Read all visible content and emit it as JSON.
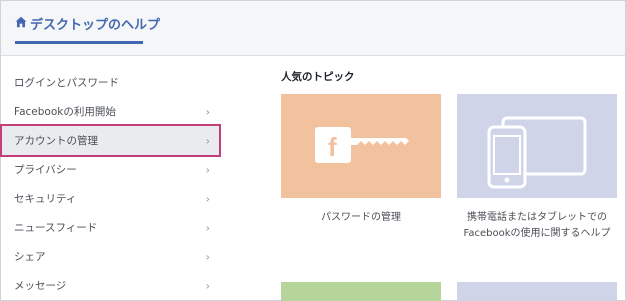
{
  "header": {
    "title": "デスクトップのヘルプ",
    "icon": "home-icon",
    "accent_color": "#4267b2"
  },
  "sidebar": {
    "items": [
      {
        "label": "ログインとパスワード",
        "has_chevron": false
      },
      {
        "label": "Facebookの利用開始",
        "has_chevron": true
      },
      {
        "label": "アカウントの管理",
        "has_chevron": true,
        "selected": true
      },
      {
        "label": "プライバシー",
        "has_chevron": true
      },
      {
        "label": "セキュリティ",
        "has_chevron": true
      },
      {
        "label": "ニュースフィード",
        "has_chevron": true
      },
      {
        "label": "シェア",
        "has_chevron": true
      },
      {
        "label": "メッセージ",
        "has_chevron": true
      }
    ],
    "chevron_glyph": "›",
    "highlight_color": "#c2407a"
  },
  "main": {
    "section_title": "人気のトピック",
    "cards": [
      {
        "caption": "パスワードの管理",
        "tile_color": "#f2c19d",
        "icon": "facebook-key-icon"
      },
      {
        "caption_line1": "携帯電話またはタブレットでの",
        "caption_line2": "Facebookの使用に関するヘルプ",
        "tile_color": "#cfd4e8",
        "icon": "phone-tablet-icon"
      },
      {
        "tile_color": "#b6d59a"
      },
      {
        "tile_color": "#cfd4e8"
      }
    ]
  }
}
